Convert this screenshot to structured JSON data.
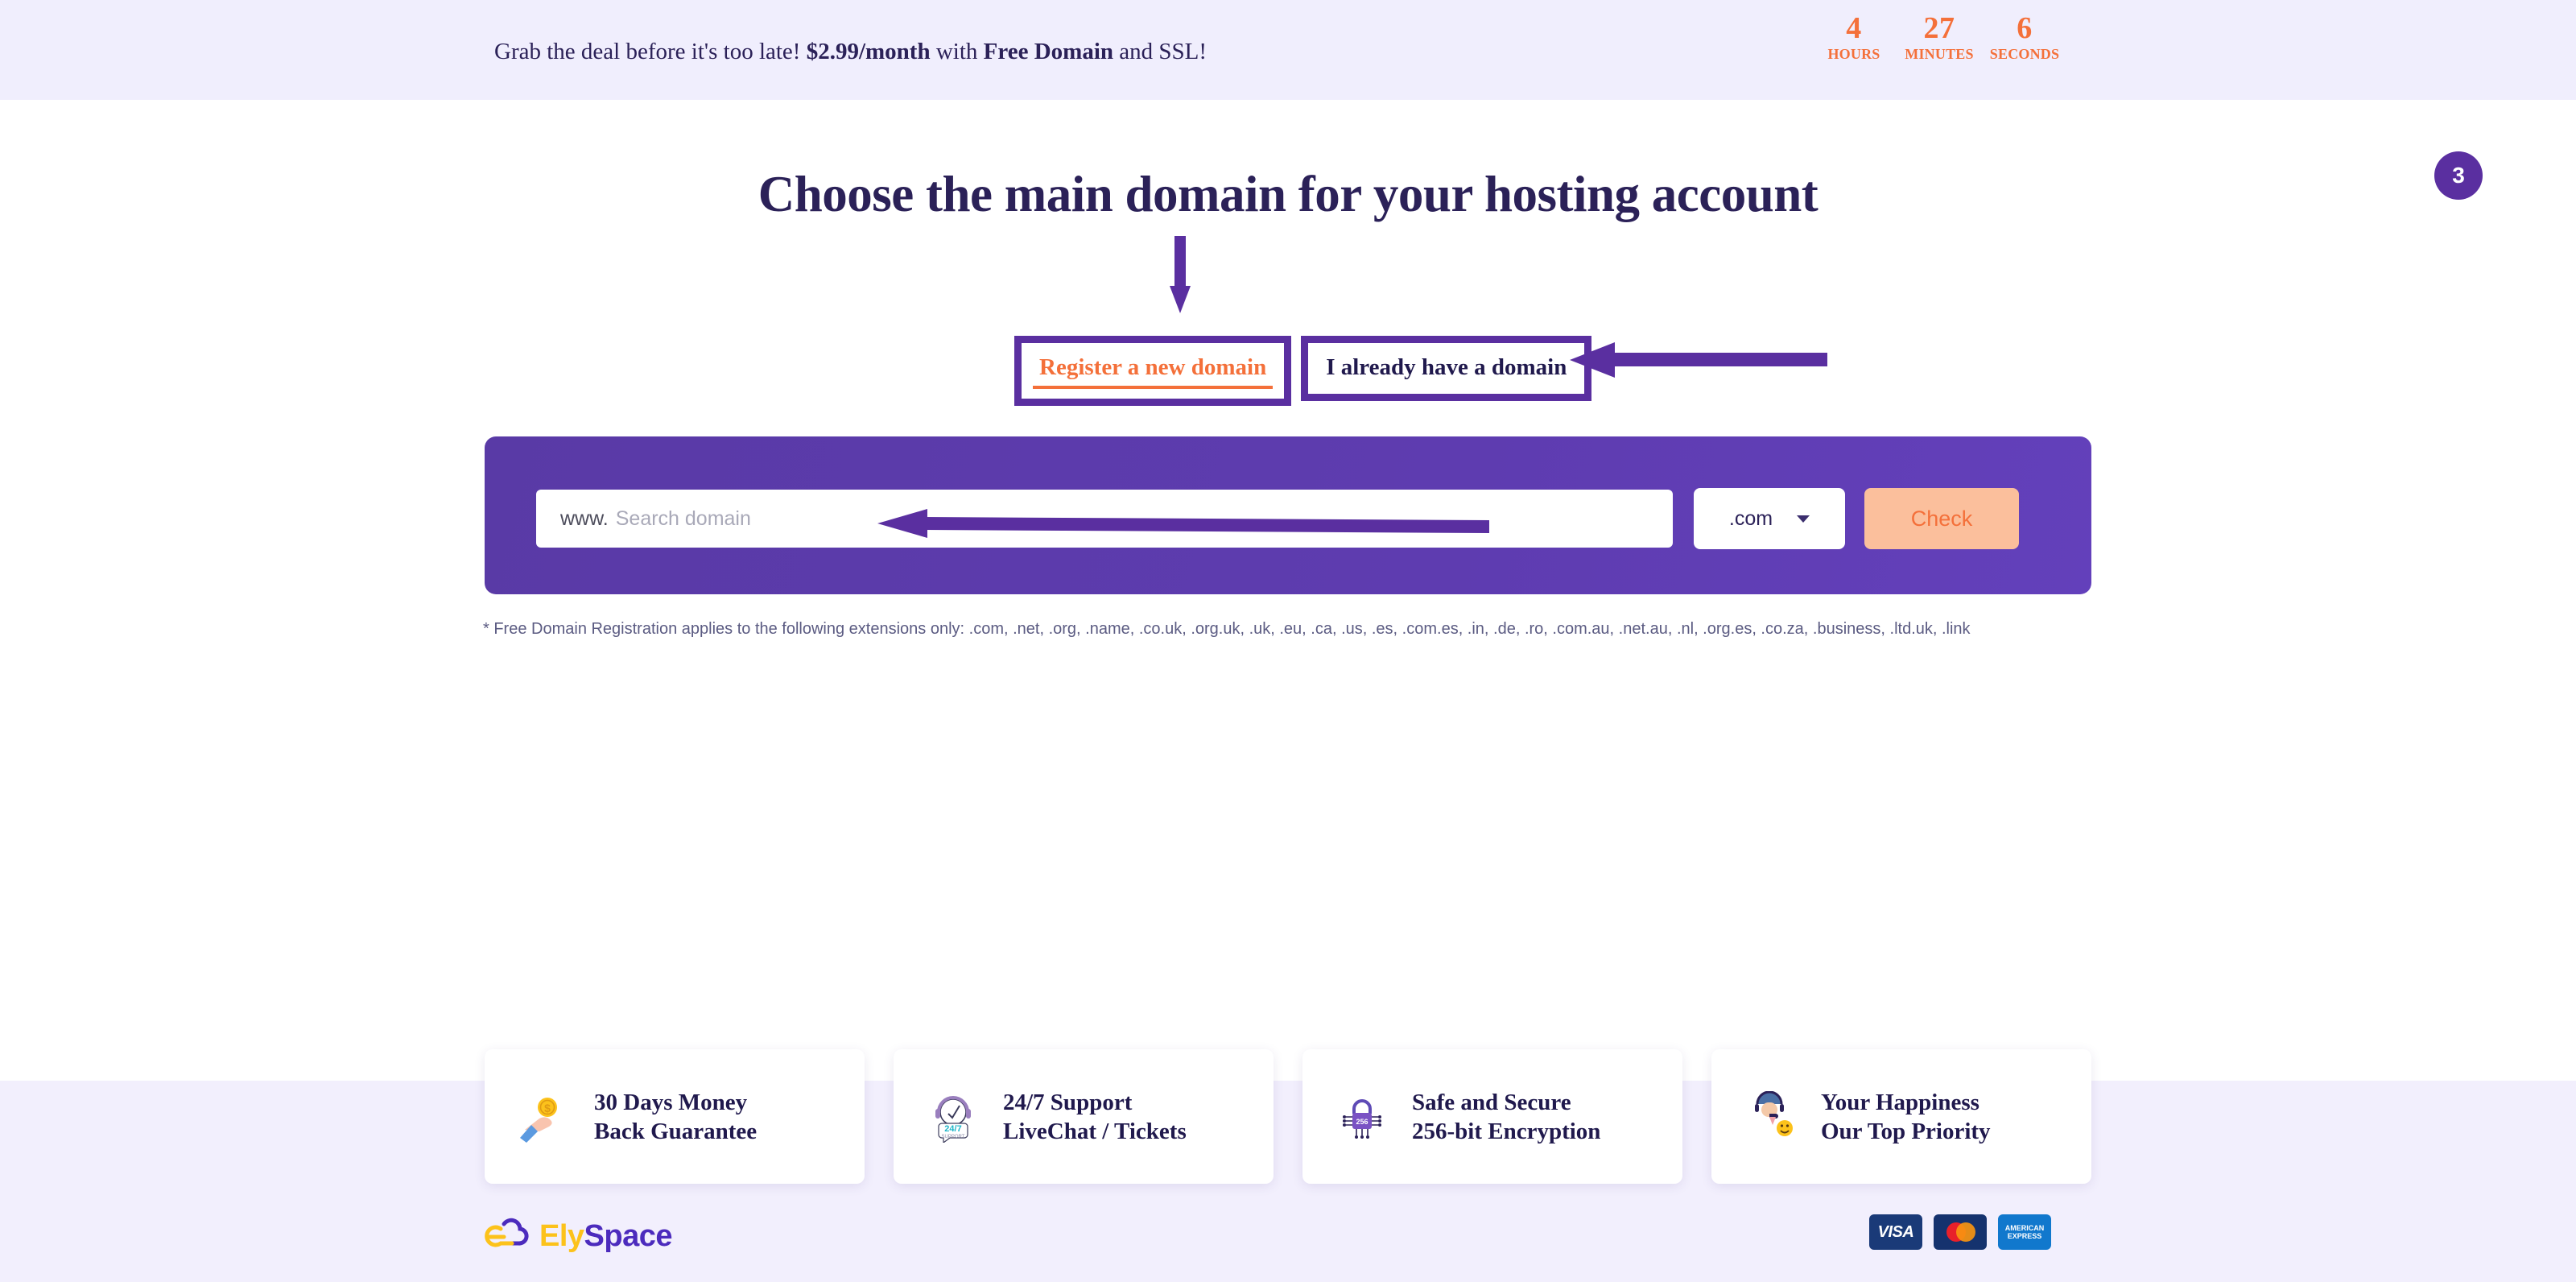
{
  "promo": {
    "text_before": "Grab the deal before it's too late! ",
    "price": "$2.99/month",
    "text_mid": " with ",
    "feature": "Free Domain",
    "text_after": " and SSL!",
    "full_text": "Grab the deal before it's too late! $2.99/month with Free Domain and SSL!"
  },
  "countdown": {
    "units": [
      {
        "value": "4",
        "label": "HOURS"
      },
      {
        "value": "27",
        "label": "MINUTES"
      },
      {
        "value": "6",
        "label": "SECONDS"
      }
    ],
    "color": "#f4703a"
  },
  "step_badge": {
    "number": "3",
    "color": "#5a2fa0"
  },
  "heading": {
    "title": "Choose the main domain for your hosting account",
    "color": "#2b2158"
  },
  "tabs": [
    {
      "label": "Register a new domain",
      "active": true,
      "color": "#f4703a"
    },
    {
      "label": "I already have a domain",
      "active": false,
      "color": "#20194d"
    }
  ],
  "search": {
    "prefix": "www.",
    "placeholder": "Search domain",
    "value": "",
    "tld_selected": ".com",
    "check_label": "Check",
    "panel_color": "#5a3aa8",
    "check_bg": "#fbbf9c",
    "check_text_color": "#f4703a"
  },
  "fine_print": {
    "line1": "* Free Domain Registration applies to the following extensions only: .com, .net, .org, .name, .co.uk, .org.uk, .uk, .eu, .ca, .us, .es, .com.es, .in, .de, .ro, .com.au, .net.au, .nl, .org.es, .co.za, .business,",
    "line2": ".ltd.uk, .link"
  },
  "feature_cards": [
    {
      "icon": "coin-hand-icon",
      "line1": "30 Days Money",
      "line2": "Back Guarantee"
    },
    {
      "icon": "clock-support-icon",
      "line1": "24/7 Support",
      "line2": "LiveChat / Tickets"
    },
    {
      "icon": "lock-chip-icon",
      "line1": "Safe and Secure",
      "line2": "256-bit Encryption"
    },
    {
      "icon": "agent-headset-icon",
      "line1": "Your Happiness",
      "line2": "Our Top Priority"
    }
  ],
  "footer": {
    "logo_part1": "Ely",
    "logo_part2": "Space",
    "logo_color1": "#fcc21b",
    "logo_color2": "#4c2bbd",
    "payment_methods": [
      {
        "name": "visa",
        "label": "VISA"
      },
      {
        "name": "mastercard",
        "label": ""
      },
      {
        "name": "amex",
        "label_line1": "AMERICAN",
        "label_line2": "EXPRESS"
      }
    ]
  },
  "annotations": {
    "arrow_to_register_tab": "down-arrow",
    "arrow_to_existing_tab": "left-arrow",
    "arrow_to_search_field": "left-arrow",
    "box_register_tab": "highlight-box",
    "box_existing_tab": "highlight-box",
    "color": "#5a2fa0"
  }
}
